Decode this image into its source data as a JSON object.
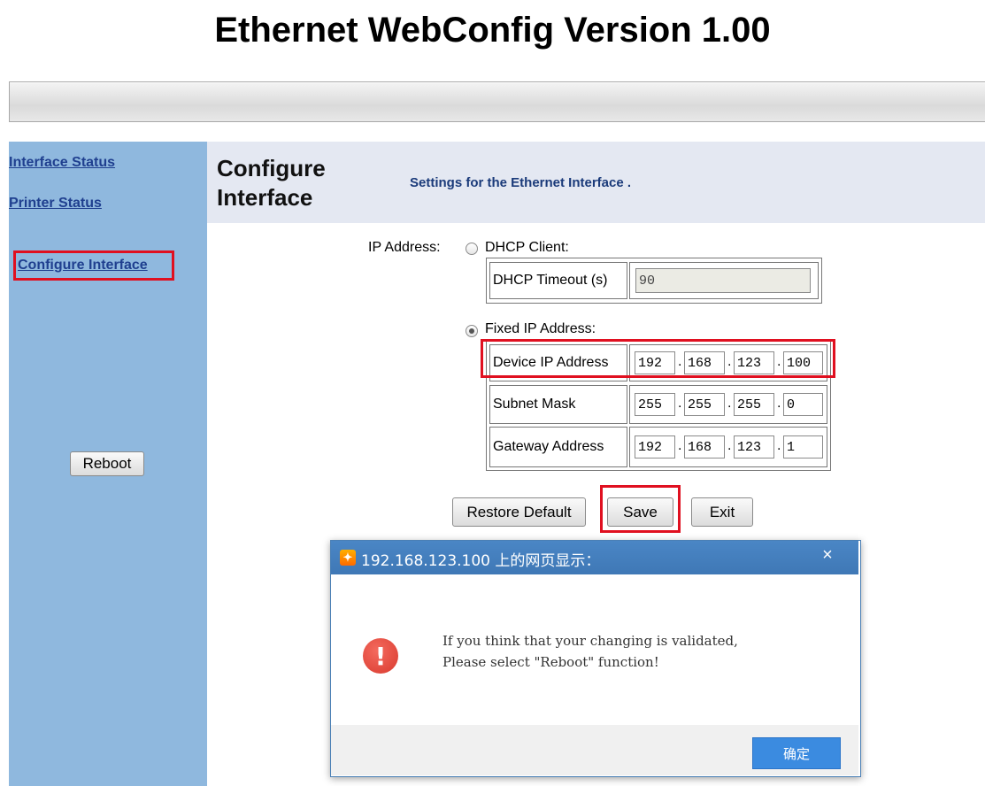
{
  "app": {
    "title": "Ethernet WebConfig Version 1.00"
  },
  "sidebar": {
    "links": [
      "Interface Status",
      "Printer Status",
      "Configure Interface"
    ],
    "reboot_label": "Reboot"
  },
  "main": {
    "title": "Configure Interface",
    "subtitle": "Settings for the Ethernet Interface ."
  },
  "form": {
    "ip_address_label": "IP Address:",
    "dhcp_client_label": "DHCP Client:",
    "dhcp_timeout_label": "DHCP Timeout (s)",
    "dhcp_timeout_value": "90",
    "fixed_ip_label": "Fixed IP Address:",
    "mode_selected": "Fixed IP Address",
    "device_ip": {
      "label": "Device IP Address",
      "octets": [
        "192",
        "168",
        "123",
        "100"
      ]
    },
    "subnet": {
      "label": "Subnet Mask",
      "octets": [
        "255",
        "255",
        "255",
        "0"
      ]
    },
    "gateway": {
      "label": "Gateway Address",
      "octets": [
        "192",
        "168",
        "123",
        "1"
      ]
    }
  },
  "buttons": {
    "restore_default": "Restore Default",
    "save": "Save",
    "exit": "Exit"
  },
  "dialog": {
    "title": "192.168.123.100 上的网页显示：",
    "close": "×",
    "message_line1": "If you think that your changing is validated,",
    "message_line2": "Please select \"Reboot\" function!",
    "ok_label": "确定"
  },
  "colors": {
    "sidebar_bg": "#8fb8de",
    "highlight_box": "#e01020",
    "dialog_title_bg": "#4a86c5",
    "ok_button": "#3b8be0"
  }
}
